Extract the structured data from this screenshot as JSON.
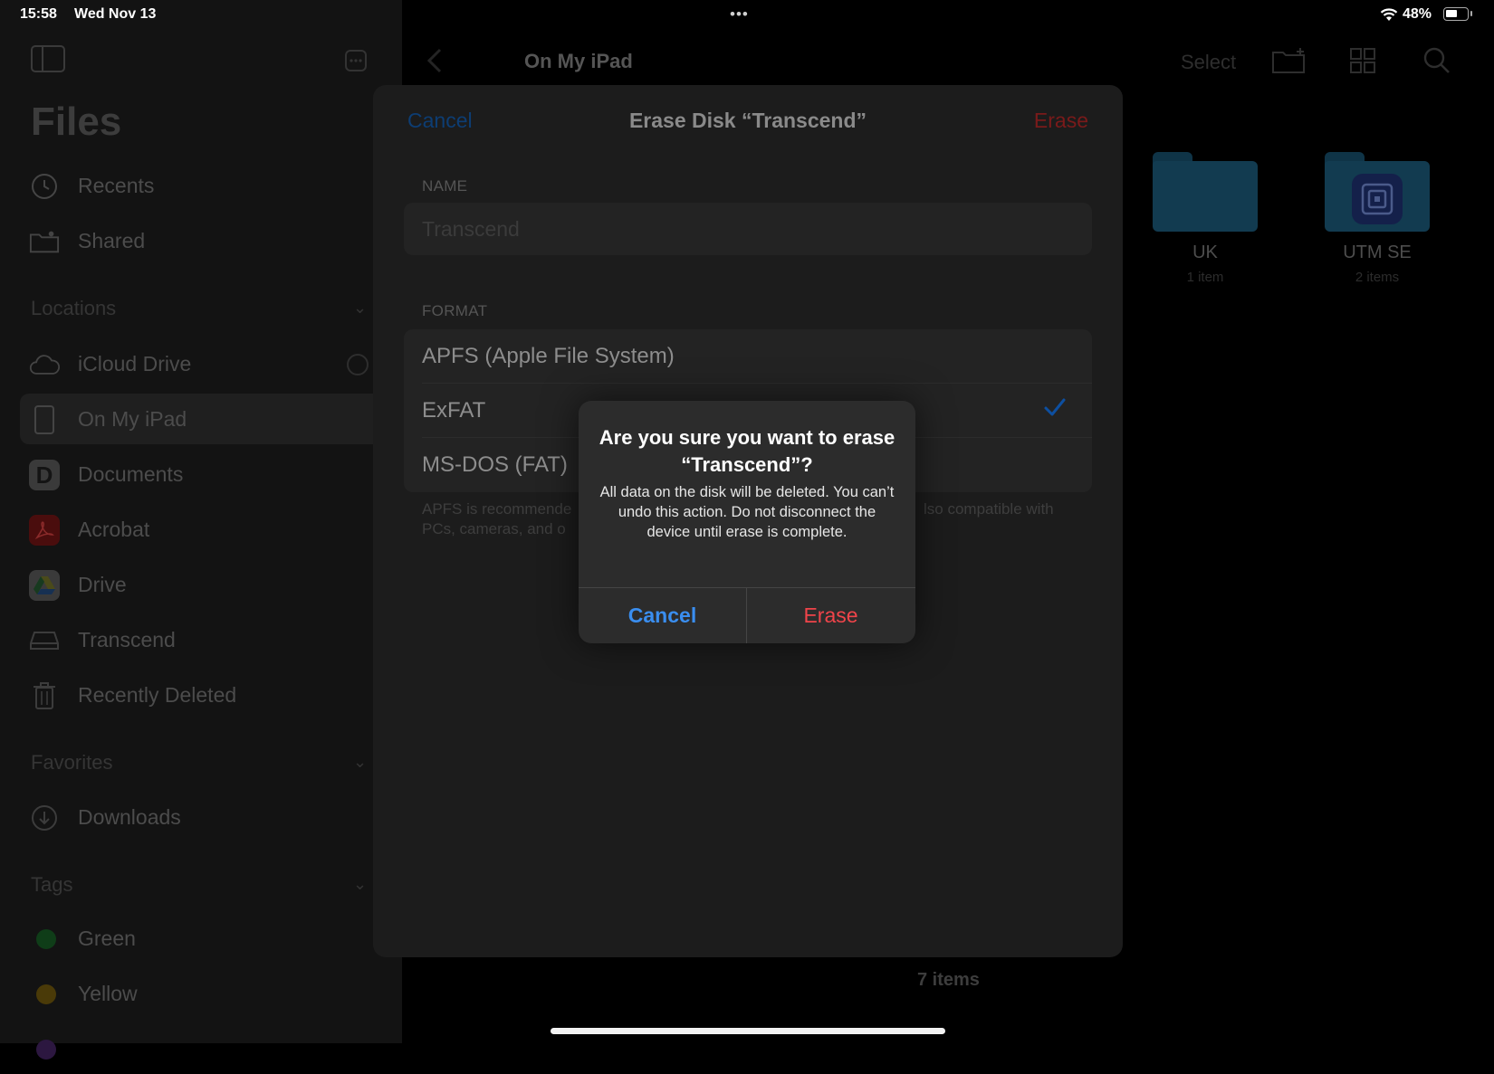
{
  "status_bar": {
    "time": "15:58",
    "date": "Wed Nov 13",
    "multitask_dots": "•••",
    "battery_percent": "48%"
  },
  "sidebar": {
    "title": "Files",
    "top_items": [
      {
        "label": "Recents",
        "icon": "clock-icon"
      },
      {
        "label": "Shared",
        "icon": "shared-folder-icon"
      }
    ],
    "locations_header": "Locations",
    "locations": [
      {
        "label": "iCloud Drive",
        "icon": "cloud-icon"
      },
      {
        "label": "On My iPad",
        "icon": "ipad-icon",
        "selected": true
      },
      {
        "label": "Documents",
        "icon": "documents-app-icon"
      },
      {
        "label": "Acrobat",
        "icon": "acrobat-icon"
      },
      {
        "label": "Drive",
        "icon": "google-drive-icon"
      },
      {
        "label": "Transcend",
        "icon": "external-drive-icon"
      },
      {
        "label": "Recently Deleted",
        "icon": "trash-icon"
      }
    ],
    "favorites_header": "Favorites",
    "favorites": [
      {
        "label": "Downloads",
        "icon": "download-icon"
      }
    ],
    "tags_header": "Tags",
    "tags": [
      {
        "label": "Green",
        "color": "#1f7a2c"
      },
      {
        "label": "Yellow",
        "color": "#8a6a10"
      }
    ]
  },
  "main": {
    "title": "On My iPad",
    "select_label": "Select",
    "folders": [
      {
        "name": "UK",
        "count": "1 item"
      },
      {
        "name": "UTM SE",
        "count": "2 items"
      }
    ],
    "items_count": "7 items"
  },
  "sheet": {
    "cancel_label": "Cancel",
    "title": "Erase Disk “Transcend”",
    "erase_label": "Erase",
    "name_label": "NAME",
    "name_value": "Transcend",
    "format_label": "FORMAT",
    "formats": [
      {
        "label": "APFS (Apple File System)",
        "selected": false
      },
      {
        "label": "ExFAT",
        "selected": true
      },
      {
        "label": "MS-DOS (FAT)",
        "selected": false
      }
    ],
    "footnote_left_1": "APFS is recommende",
    "footnote_right_1": "lso compatible with",
    "footnote_left_2": "PCs, cameras, and o"
  },
  "alert": {
    "title": "Are you sure you want to erase “Transcend”?",
    "message": "All data on the disk will be deleted. You can’t undo this action. Do not disconnect the device until erase is complete.",
    "cancel_label": "Cancel",
    "erase_label": "Erase"
  },
  "colors": {
    "accent_blue": "#3a8ef0",
    "destructive_red": "#f0444a",
    "checkmark_blue": "#0a84ff"
  }
}
